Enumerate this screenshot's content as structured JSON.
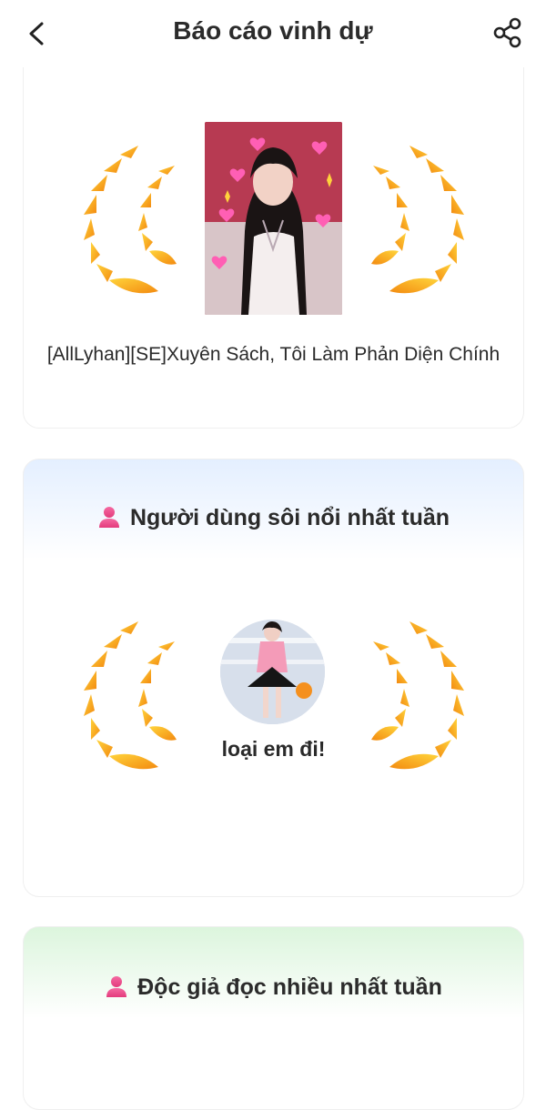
{
  "header": {
    "title": "Báo cáo vinh dự",
    "back_icon": "chevron-left-icon",
    "share_icon": "share-icon"
  },
  "book_card": {
    "book_title": "[AllLyhan][SE]Xuyên Sách, Tôi Làm Phản Diện Chính"
  },
  "active_user_card": {
    "heading": "Người dùng sôi nổi nhất tuần",
    "user_name": "loại em đi!"
  },
  "reader_card": {
    "heading": "Độc giả đọc nhiều nhất tuần"
  },
  "colors": {
    "wreath_gold": "#f7b500",
    "wreath_orange": "#f38a10",
    "user_icon_pink": "#ee4b8d",
    "blue_header_tint": "#e4efff",
    "green_header_tint": "#dcf5dd"
  }
}
